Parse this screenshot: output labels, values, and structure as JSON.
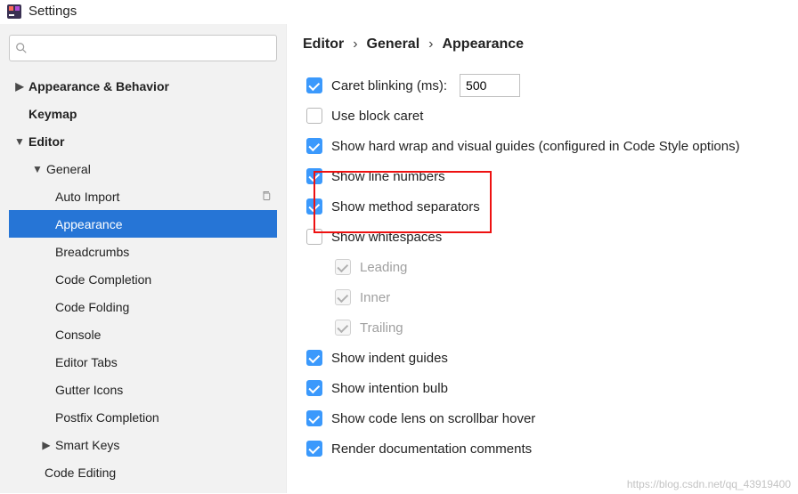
{
  "window": {
    "title": "Settings"
  },
  "search": {
    "placeholder": ""
  },
  "sidebar": {
    "items": [
      {
        "label": "Appearance & Behavior",
        "level": 0,
        "chevron": "▶",
        "bold": true
      },
      {
        "label": "Keymap",
        "level": 0,
        "chevron": "",
        "bold": true
      },
      {
        "label": "Editor",
        "level": 0,
        "chevron": "▼",
        "bold": true
      },
      {
        "label": "General",
        "level": 1,
        "chevron": "▼",
        "bold": false
      },
      {
        "label": "Auto Import",
        "level": 2,
        "chevron": "",
        "copy": true
      },
      {
        "label": "Appearance",
        "level": 2,
        "chevron": "",
        "selected": true
      },
      {
        "label": "Breadcrumbs",
        "level": 2,
        "chevron": ""
      },
      {
        "label": "Code Completion",
        "level": 2,
        "chevron": ""
      },
      {
        "label": "Code Folding",
        "level": 2,
        "chevron": ""
      },
      {
        "label": "Console",
        "level": 2,
        "chevron": ""
      },
      {
        "label": "Editor Tabs",
        "level": 2,
        "chevron": ""
      },
      {
        "label": "Gutter Icons",
        "level": 2,
        "chevron": ""
      },
      {
        "label": "Postfix Completion",
        "level": 2,
        "chevron": ""
      },
      {
        "label": "Smart Keys",
        "level": 2,
        "chevron": "▶"
      },
      {
        "label": "Code Editing",
        "level": 1,
        "chevron": ""
      }
    ]
  },
  "breadcrumbs": {
    "items": [
      "Editor",
      "General",
      "Appearance"
    ],
    "sep": "›"
  },
  "options": {
    "caret_label": "Caret blinking (ms):",
    "caret_value": "500",
    "block_caret": "Use block caret",
    "hard_wrap": "Show hard wrap and visual guides (configured in Code Style options)",
    "line_numbers": "Show line numbers",
    "method_sep": "Show method separators",
    "whitespaces": "Show whitespaces",
    "leading": "Leading",
    "inner": "Inner",
    "trailing": "Trailing",
    "indent_guides": "Show indent guides",
    "intention_bulb": "Show intention bulb",
    "code_lens": "Show code lens on scrollbar hover",
    "render_doc": "Render documentation comments"
  },
  "watermark": "https://blog.csdn.net/qq_43919400"
}
